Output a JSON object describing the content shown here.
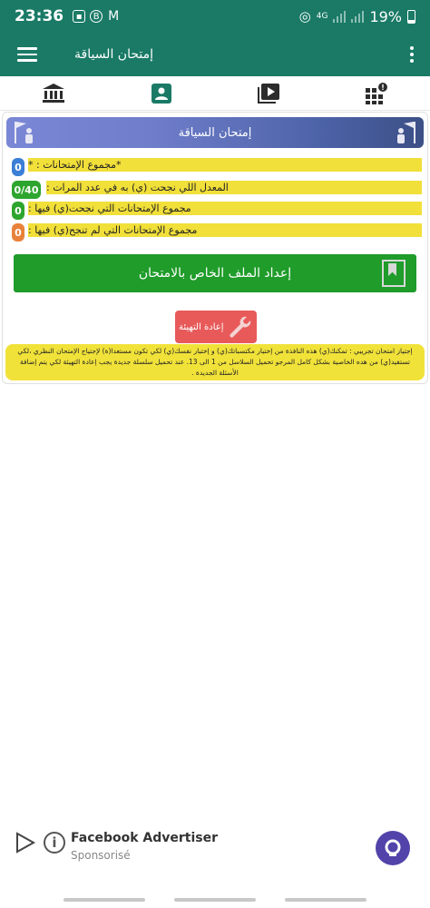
{
  "status_bar": {
    "time": "23:36",
    "network": "4G",
    "battery": "19%"
  },
  "app_bar": {
    "title": "إمتحان السياقة"
  },
  "tabs": [
    {
      "icon": "bank-icon"
    },
    {
      "icon": "profile-card-icon"
    },
    {
      "icon": "video-playlist-icon"
    },
    {
      "icon": "grid-alert-icon"
    }
  ],
  "banner": {
    "title": "إمتحان السياقة"
  },
  "stats": [
    {
      "label": "*مجموع الإمتحانات : *",
      "value": "0",
      "color": "#3b7fd6"
    },
    {
      "label": "المعدل اللي نجحت (ي) به في عدد المرات :",
      "value": "0/40",
      "color": "#2ea52e"
    },
    {
      "label": "مجموع الإمتحانات التي نجحت(ي) فيها :",
      "value": "0",
      "color": "#2ea52e"
    },
    {
      "label": "مجموع الإمتحانات التي لم تنجح(ي) فيها :",
      "value": "0",
      "color": "#e8823a"
    }
  ],
  "prep_button": {
    "label": "إعداد الملف الخاص بالامتحان"
  },
  "reset_button": {
    "label": "إعادة التهيئة"
  },
  "note": {
    "text": "إجتياز امتحان تجريبي : تمكنك(ي) هذه النافذة من إختبار مكتسباتك(ي) و إختبار نفسك(ي) لكي تكون مستعدا(ة) لإجتياج الإمتحان النظري ،لكي تستفيد(ي) من هده الخاصية بشكل كامل المرجو تحميل السلاسل من 1 الى 13. عند تحميل سلسلة جديدة يجب إعادة التهيئة لكي يتم إضافة الأسئلة الجديدة ."
  },
  "ad": {
    "title": "Facebook Advertiser",
    "subtitle": "Sponsorisé"
  }
}
